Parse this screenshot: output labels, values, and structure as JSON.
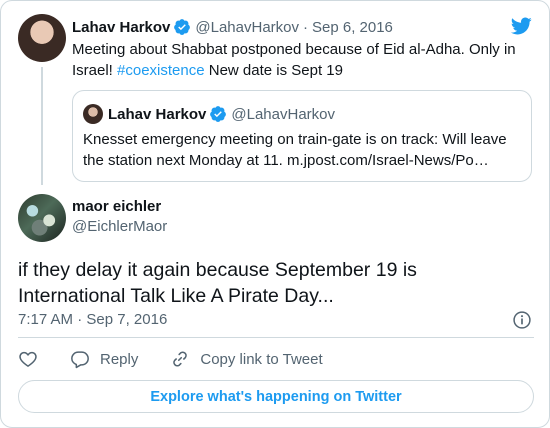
{
  "parent_tweet": {
    "author_name": "Lahav Harkov",
    "author_handle": "@LahavHarkov",
    "separator": "·",
    "date": "Sep 6, 2016",
    "text_before": "Meeting about Shabbat postponed because of Eid al-Adha. Only in Israel! ",
    "hashtag": "#coexistence",
    "text_after": " New date is Sept 19",
    "quoted_tweet": {
      "author_name": "Lahav Harkov",
      "author_handle": "@LahavHarkov",
      "text": "Knesset emergency meeting on train-gate is on track: Will leave the station next Monday at 11.  m.jpost.com/Israel-News/Po…"
    }
  },
  "reply_tweet": {
    "author_name": "maor eichler",
    "author_handle": "@EichlerMaor",
    "text": "if they delay it again because September 19 is International Talk Like A Pirate Day...",
    "time": "7:17 AM",
    "separator": "·",
    "date": "Sep 7, 2016"
  },
  "actions": {
    "reply_label": "Reply",
    "copy_link_label": "Copy link to Tweet"
  },
  "explore_label": "Explore what's happening on Twitter",
  "colors": {
    "accent": "#1d9bf0",
    "text": "#0f1419",
    "secondary": "#536471",
    "border": "#cfd9de"
  },
  "icons": [
    "verified-badge-icon",
    "twitter-bird-icon",
    "info-icon",
    "heart-icon",
    "reply-bubble-icon",
    "link-icon"
  ]
}
